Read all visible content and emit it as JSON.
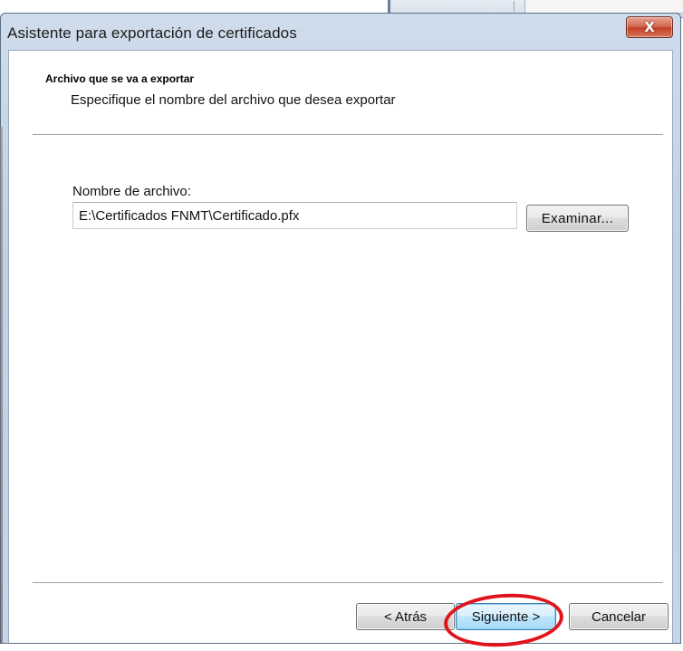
{
  "window": {
    "title": "Asistente para exportación de certificados",
    "close_icon_glyph": "X"
  },
  "header": {
    "section_title": "Archivo que se va a exportar",
    "section_subtitle": "Especifique el nombre del archivo que desea exportar"
  },
  "form": {
    "filename_label": "Nombre de archivo:",
    "filename_value": "E:\\Certificados FNMT\\Certificado.pfx",
    "browse_label": "Examinar..."
  },
  "footer": {
    "back_label": "< Atrás",
    "next_label": "Siguiente >",
    "cancel_label": "Cancelar"
  },
  "colors": {
    "highlight": "#e0141c",
    "close_button": "#c3412a",
    "frame": "#bfd0e4"
  },
  "icons": {
    "close": "close-icon"
  }
}
